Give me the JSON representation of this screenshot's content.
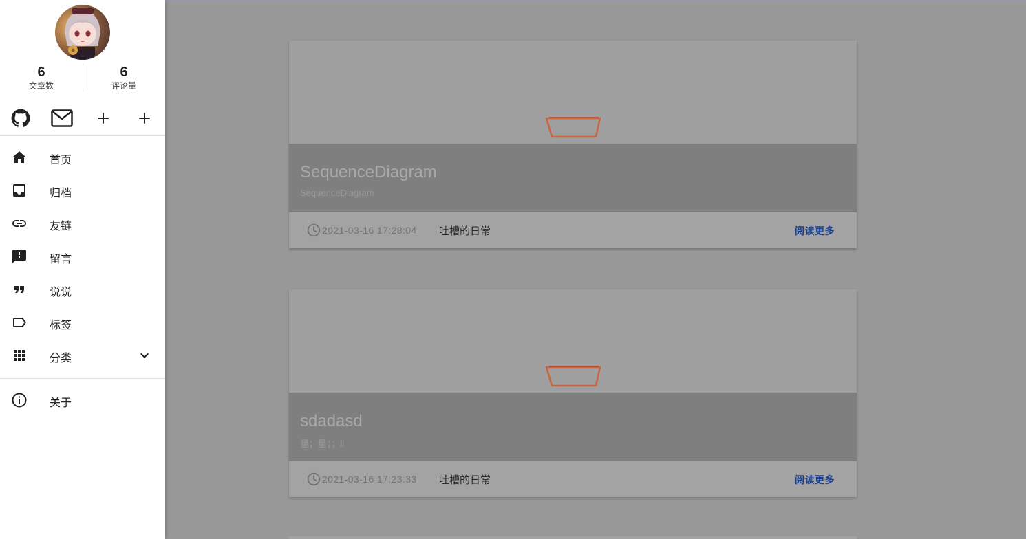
{
  "sidebar": {
    "stats": [
      {
        "value": "6",
        "label": "文章数"
      },
      {
        "value": "6",
        "label": "评论量"
      }
    ],
    "social": [
      {
        "icon": "github-icon"
      },
      {
        "icon": "mail-icon"
      },
      {
        "icon": "plus-icon"
      },
      {
        "icon": "plus-icon"
      }
    ],
    "nav": [
      {
        "label": "首页",
        "icon": "home-icon"
      },
      {
        "label": "归档",
        "icon": "inbox-icon"
      },
      {
        "label": "友链",
        "icon": "link-icon"
      },
      {
        "label": "留言",
        "icon": "feedback-icon"
      },
      {
        "label": "说说",
        "icon": "quote-icon"
      },
      {
        "label": "标签",
        "icon": "tag-icon"
      },
      {
        "label": "分类",
        "icon": "apps-grid-icon"
      },
      {
        "label": "关于",
        "icon": "info-icon"
      }
    ]
  },
  "posts": [
    {
      "title": "SequenceDiagram",
      "subtitle": "SequenceDiagram",
      "date": "2021-03-16 17:28:04",
      "category": "吐槽的日常",
      "read_more": "阅读更多"
    },
    {
      "title": "sdadasd",
      "subtitle": "量；量；；ll",
      "date": "2021-03-16 17:23:33",
      "category": "吐槽的日常",
      "read_more": "阅读更多"
    }
  ],
  "colors": {
    "accent_link": "#1a3f8f",
    "overlay": "#7f7f7f",
    "backdrop": "#999999"
  }
}
